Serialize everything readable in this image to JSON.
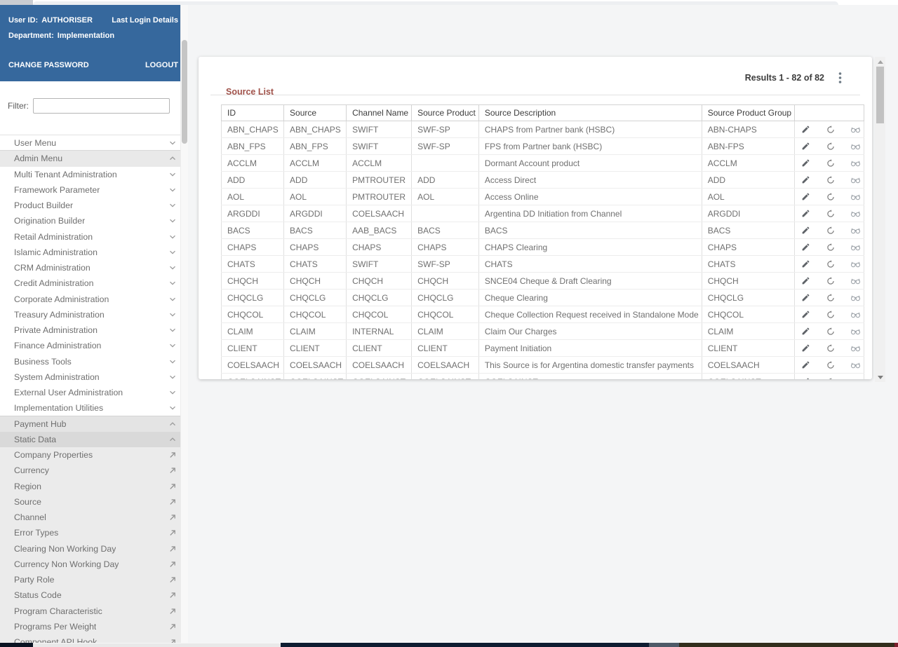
{
  "colors": {
    "header_blue": "#36689d",
    "title_brick": "#a0524a",
    "page_background": "#f4f5f6",
    "menu_text": "#6f6f6f",
    "cell_text": "#707070"
  },
  "sidebar": {
    "header": {
      "user_id_label": "User ID:",
      "user_id_value": "AUTHORISER",
      "last_login_link": "Last Login Details",
      "department_label": "Department:",
      "department_value": "Implementation",
      "change_password_label": "CHANGE PASSWORD",
      "logout_label": "LOGOUT"
    },
    "filter_label": "Filter:",
    "filter_value": "",
    "menu": [
      {
        "label": "User Menu",
        "icon": "chevron-down",
        "style": "top"
      },
      {
        "label": "Admin Menu",
        "icon": "chevron-up",
        "style": "group-open"
      },
      {
        "label": "Multi Tenant Administration",
        "icon": "chevron-down",
        "style": "top"
      },
      {
        "label": "Framework Parameter",
        "icon": "chevron-down",
        "style": "top"
      },
      {
        "label": "Product Builder",
        "icon": "chevron-down",
        "style": "top"
      },
      {
        "label": "Origination Builder",
        "icon": "chevron-down",
        "style": "top"
      },
      {
        "label": "Retail Administration",
        "icon": "chevron-down",
        "style": "top"
      },
      {
        "label": "Islamic Administration",
        "icon": "chevron-down",
        "style": "top"
      },
      {
        "label": "CRM Administration",
        "icon": "chevron-down",
        "style": "top"
      },
      {
        "label": "Credit Administration",
        "icon": "chevron-down",
        "style": "top"
      },
      {
        "label": "Corporate Administration",
        "icon": "chevron-down",
        "style": "top"
      },
      {
        "label": "Treasury Administration",
        "icon": "chevron-down",
        "style": "top"
      },
      {
        "label": "Private Administration",
        "icon": "chevron-down",
        "style": "top"
      },
      {
        "label": "Finance Administration",
        "icon": "chevron-down",
        "style": "top"
      },
      {
        "label": "Business Tools",
        "icon": "chevron-down",
        "style": "top"
      },
      {
        "label": "System Administration",
        "icon": "chevron-down",
        "style": "top"
      },
      {
        "label": "External User Administration",
        "icon": "chevron-down",
        "style": "top"
      },
      {
        "label": "Implementation Utilities",
        "icon": "chevron-down",
        "style": "top"
      },
      {
        "label": "Payment Hub",
        "icon": "chevron-up",
        "style": "hub-open"
      },
      {
        "label": "Static Data",
        "icon": "chevron-up",
        "style": "static-open"
      },
      {
        "label": "Company Properties",
        "icon": "open-in-new",
        "style": "subitem"
      },
      {
        "label": "Currency",
        "icon": "open-in-new",
        "style": "subitem"
      },
      {
        "label": "Region",
        "icon": "open-in-new",
        "style": "subitem"
      },
      {
        "label": "Source",
        "icon": "open-in-new",
        "style": "subitem"
      },
      {
        "label": "Channel",
        "icon": "open-in-new",
        "style": "subitem"
      },
      {
        "label": "Error Types",
        "icon": "open-in-new",
        "style": "subitem"
      },
      {
        "label": "Clearing Non Working Day",
        "icon": "open-in-new",
        "style": "subitem"
      },
      {
        "label": "Currency Non Working Day",
        "icon": "open-in-new",
        "style": "subitem"
      },
      {
        "label": "Party Role",
        "icon": "open-in-new",
        "style": "subitem"
      },
      {
        "label": "Status Code",
        "icon": "open-in-new",
        "style": "subitem"
      },
      {
        "label": "Program Characteristic",
        "icon": "open-in-new",
        "style": "subitem"
      },
      {
        "label": "Programs Per Weight",
        "icon": "open-in-new",
        "style": "subitem"
      },
      {
        "label": "Component API Hook",
        "icon": "open-in-new",
        "style": "subitem"
      }
    ]
  },
  "main": {
    "title": "Source List",
    "results_text": "Results 1 - 82 of 82",
    "table": {
      "columns": [
        "ID",
        "Source",
        "Channel Name",
        "Source Product",
        "Source Description",
        "Source Product Group",
        ""
      ],
      "row_actions": [
        "edit",
        "history",
        "view"
      ],
      "rows": [
        [
          "ABN_CHAPS",
          "ABN_CHAPS",
          "SWIFT",
          "SWF-SP",
          "CHAPS from Partner bank (HSBC)",
          "ABN-CHAPS"
        ],
        [
          "ABN_FPS",
          "ABN_FPS",
          "SWIFT",
          "SWF-SP",
          "FPS from Partner bank (HSBC)",
          "ABN-FPS"
        ],
        [
          "ACCLM",
          "ACCLM",
          "ACCLM",
          "",
          "Dormant Account product",
          "ACCLM"
        ],
        [
          "ADD",
          "ADD",
          "PMTROUTER",
          "ADD",
          "Access Direct",
          "ADD"
        ],
        [
          "AOL",
          "AOL",
          "PMTROUTER",
          "AOL",
          "Access Online",
          "AOL"
        ],
        [
          "ARGDDI",
          "ARGDDI",
          "COELSAACH",
          "",
          "Argentina DD Initiation from Channel",
          "ARGDDI"
        ],
        [
          "BACS",
          "BACS",
          "AAB_BACS",
          "BACS",
          "BACS",
          "BACS"
        ],
        [
          "CHAPS",
          "CHAPS",
          "CHAPS",
          "CHAPS",
          "CHAPS Clearing",
          "CHAPS"
        ],
        [
          "CHATS",
          "CHATS",
          "SWIFT",
          "SWF-SP",
          "CHATS",
          "CHATS"
        ],
        [
          "CHQCH",
          "CHQCH",
          "CHQCH",
          "CHQCH",
          "SNCE04 Cheque & Draft Clearing",
          "CHQCH"
        ],
        [
          "CHQCLG",
          "CHQCLG",
          "CHQCLG",
          "CHQCLG",
          "Cheque Clearing",
          "CHQCLG"
        ],
        [
          "CHQCOL",
          "CHQCOL",
          "CHQCOL",
          "CHQCOL",
          "Cheque Collection Request received in Standalone Mode",
          "CHQCOL"
        ],
        [
          "CLAIM",
          "CLAIM",
          "INTERNAL",
          "CLAIM",
          "Claim Our Charges",
          "CLAIM"
        ],
        [
          "CLIENT",
          "CLIENT",
          "CLIENT",
          "CLIENT",
          "Payment Initiation",
          "CLIENT"
        ],
        [
          "COELSAACH",
          "COELSAACH",
          "COELSAACH",
          "COELSAACH",
          "This Source is for Argentina domestic transfer payments",
          "COELSAACH"
        ],
        [
          "COELSAINST",
          "COELSAINST",
          "COELSAINST",
          "COELSAINST",
          "COELSAINST",
          "COELSAINST"
        ]
      ]
    }
  }
}
